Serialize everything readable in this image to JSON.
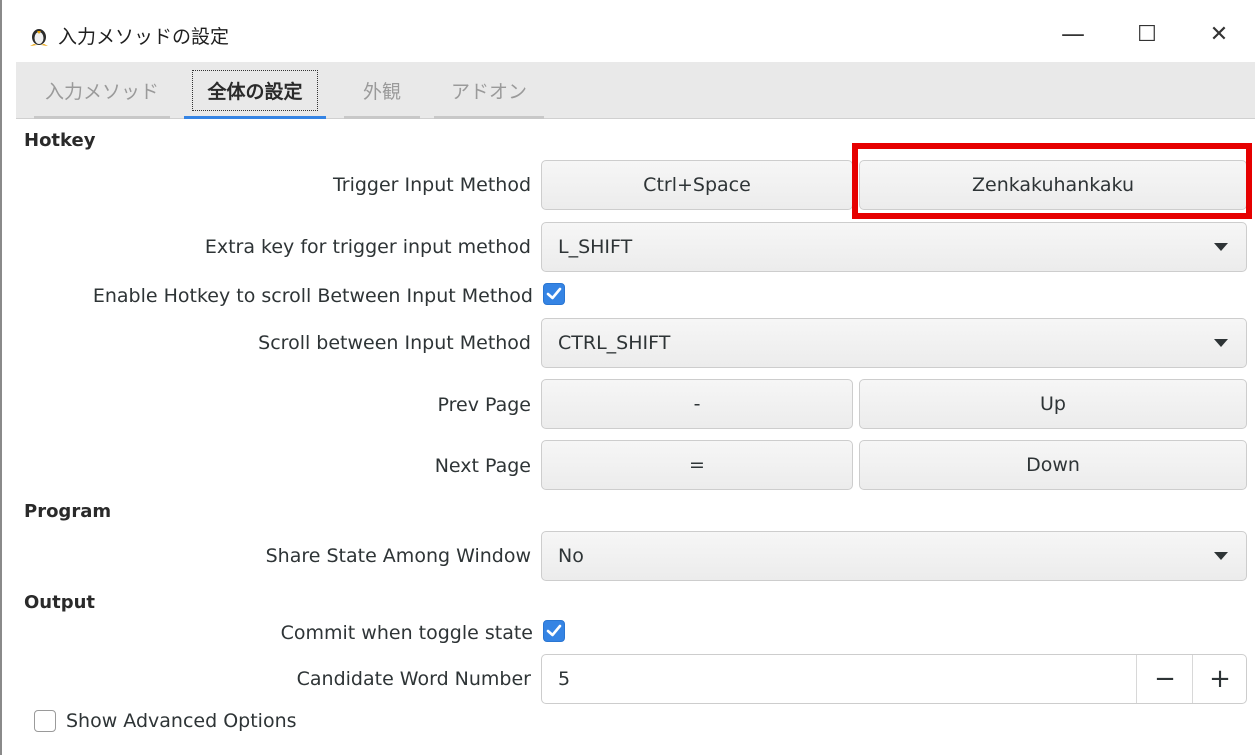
{
  "window": {
    "title": "入力メソッドの設定",
    "minimize": "—",
    "maximize": "☐",
    "close": "✕"
  },
  "tabs": [
    {
      "label": "入力メソッド",
      "active": false
    },
    {
      "label": "全体の設定",
      "active": true
    },
    {
      "label": "外観",
      "active": false
    },
    {
      "label": "アドオン",
      "active": false
    }
  ],
  "sections": {
    "hotkey": "Hotkey",
    "program": "Program",
    "output": "Output"
  },
  "hotkey": {
    "trigger_label": "Trigger Input Method",
    "trigger_key1": "Ctrl+Space",
    "trigger_key2": "Zenkakuhankaku",
    "extra_label": "Extra key for trigger input method",
    "extra_value": "L_SHIFT",
    "enable_scroll_label": "Enable Hotkey to scroll Between Input Method",
    "enable_scroll_checked": true,
    "scroll_label": "Scroll between Input Method",
    "scroll_value": "CTRL_SHIFT",
    "prev_label": "Prev Page",
    "prev_key1": "-",
    "prev_key2": "Up",
    "next_label": "Next Page",
    "next_key1": "=",
    "next_key2": "Down"
  },
  "program": {
    "share_label": "Share State Among Window",
    "share_value": "No"
  },
  "output": {
    "commit_label": "Commit when toggle state",
    "commit_checked": true,
    "candidate_label": "Candidate Word Number",
    "candidate_value": "5",
    "minus": "−",
    "plus": "+"
  },
  "advanced": {
    "label": "Show Advanced Options",
    "checked": false
  },
  "colors": {
    "accent": "#3584e4",
    "highlight": "#e60000"
  }
}
